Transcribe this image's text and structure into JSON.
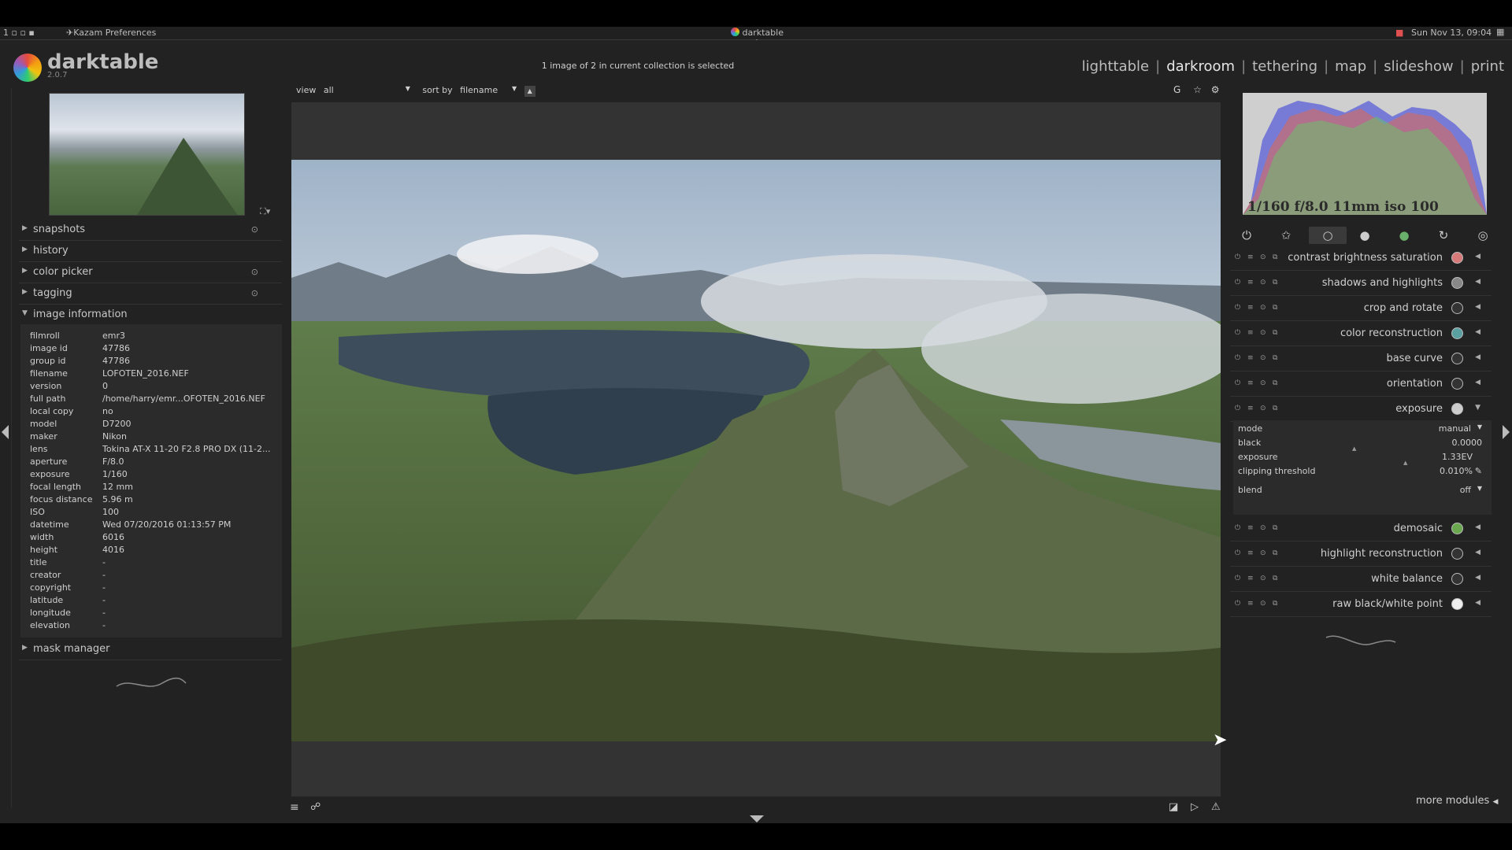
{
  "taskbar": {
    "left_text": "1 ▫ ▫ ▪",
    "kazam": "Kazam Preferences",
    "window_title": "darktable",
    "clock": "Sun Nov 13, 09:04"
  },
  "app": {
    "name": "darktable",
    "version": "2.0.7",
    "collection_status": "1 image of 2 in current collection is selected",
    "views": [
      "lighttable",
      "darkroom",
      "tethering",
      "map",
      "slideshow",
      "print"
    ],
    "active_view": "darkroom"
  },
  "filter": {
    "view_label": "view",
    "view_value": "all",
    "sort_label": "sort by",
    "sort_value": "filename",
    "grouping": "G"
  },
  "left_panel": {
    "sections": [
      {
        "label": "snapshots"
      },
      {
        "label": "history"
      },
      {
        "label": "color picker"
      },
      {
        "label": "tagging"
      },
      {
        "label": "image information"
      }
    ],
    "image_info": [
      {
        "k": "filmroll",
        "v": "emr3"
      },
      {
        "k": "image id",
        "v": "47786"
      },
      {
        "k": "group id",
        "v": "47786"
      },
      {
        "k": "filename",
        "v": "LOFOTEN_2016.NEF"
      },
      {
        "k": "version",
        "v": "0"
      },
      {
        "k": "full path",
        "v": "/home/harry/emr...OFOTEN_2016.NEF"
      },
      {
        "k": "local copy",
        "v": "no"
      },
      {
        "k": "model",
        "v": "D7200"
      },
      {
        "k": "maker",
        "v": "Nikon"
      },
      {
        "k": "lens",
        "v": "Tokina AT-X 11-20 F2.8 PRO DX (11-2..."
      },
      {
        "k": "aperture",
        "v": "F/8.0"
      },
      {
        "k": "exposure",
        "v": "1/160"
      },
      {
        "k": "focal length",
        "v": "12 mm"
      },
      {
        "k": "focus distance",
        "v": "5.96 m"
      },
      {
        "k": "ISO",
        "v": "100"
      },
      {
        "k": "datetime",
        "v": "Wed 07/20/2016 01:13:57 PM"
      },
      {
        "k": "width",
        "v": "6016"
      },
      {
        "k": "height",
        "v": "4016"
      },
      {
        "k": "title",
        "v": "-"
      },
      {
        "k": "creator",
        "v": "-"
      },
      {
        "k": "copyright",
        "v": "-"
      },
      {
        "k": "latitude",
        "v": "-"
      },
      {
        "k": "longitude",
        "v": "-"
      },
      {
        "k": "elevation",
        "v": "-"
      }
    ],
    "mask_manager": "mask manager"
  },
  "histogram": {
    "exif_line": "1/160 f/8.0 11mm iso 100"
  },
  "modules": [
    {
      "name": "contrast brightness saturation",
      "icon_color": "#d87a7a"
    },
    {
      "name": "shadows and highlights",
      "icon_color": "#888888"
    },
    {
      "name": "crop and rotate",
      "icon_color": "#333333"
    },
    {
      "name": "color reconstruction",
      "icon_color": "#5aa0a0"
    },
    {
      "name": "base curve",
      "icon_color": "#333333"
    },
    {
      "name": "orientation",
      "icon_color": "#333333"
    },
    {
      "name": "exposure",
      "icon_color": "#cccccc"
    },
    {
      "name": "demosaic",
      "icon_color": "#6aa84f"
    },
    {
      "name": "highlight reconstruction",
      "icon_color": "#333333"
    },
    {
      "name": "white balance",
      "icon_color": "#333333"
    },
    {
      "name": "raw black/white point",
      "icon_color": "#eeeeee"
    }
  ],
  "exposure_params": {
    "mode_label": "mode",
    "mode_value": "manual",
    "black_label": "black",
    "black_value": "0.0000",
    "exposure_label": "exposure",
    "exposure_value": "1.33EV",
    "clip_label": "clipping threshold",
    "clip_value": "0.010%",
    "blend_label": "blend",
    "blend_value": "off"
  },
  "more_modules": "more modules"
}
